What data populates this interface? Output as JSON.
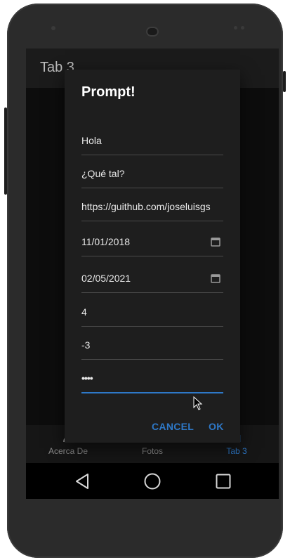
{
  "appbar": {
    "title": "Tab 3"
  },
  "dialog": {
    "title": "Prompt!",
    "fields": [
      {
        "name": "text-field",
        "value": "Hola"
      },
      {
        "name": "text-field-2",
        "value": "¿Qué tal?"
      },
      {
        "name": "url-field",
        "value": "https://guithub.com/joseluisgs"
      },
      {
        "name": "date-field",
        "value": "11/01/2018"
      },
      {
        "name": "date-field-2",
        "value": "02/05/2021"
      },
      {
        "name": "number-field",
        "value": "4"
      },
      {
        "name": "number-field-2",
        "value": "-3"
      },
      {
        "name": "password-field",
        "value": "••••"
      }
    ],
    "cancel_label": "CANCEL",
    "ok_label": "OK"
  },
  "tabs": [
    {
      "label": "Acerca De",
      "icon": "info-icon"
    },
    {
      "label": "Fotos",
      "icon": "photos-icon"
    },
    {
      "label": "Tab 3",
      "icon": "tab3-icon",
      "active": true
    }
  ],
  "navbar": {
    "icons": [
      "back-icon",
      "home-icon",
      "recents-icon"
    ]
  },
  "colors": {
    "accent": "#2e78c7",
    "dialog_bg": "#1e1e1e",
    "screen_bg": "#0f0f0f"
  }
}
